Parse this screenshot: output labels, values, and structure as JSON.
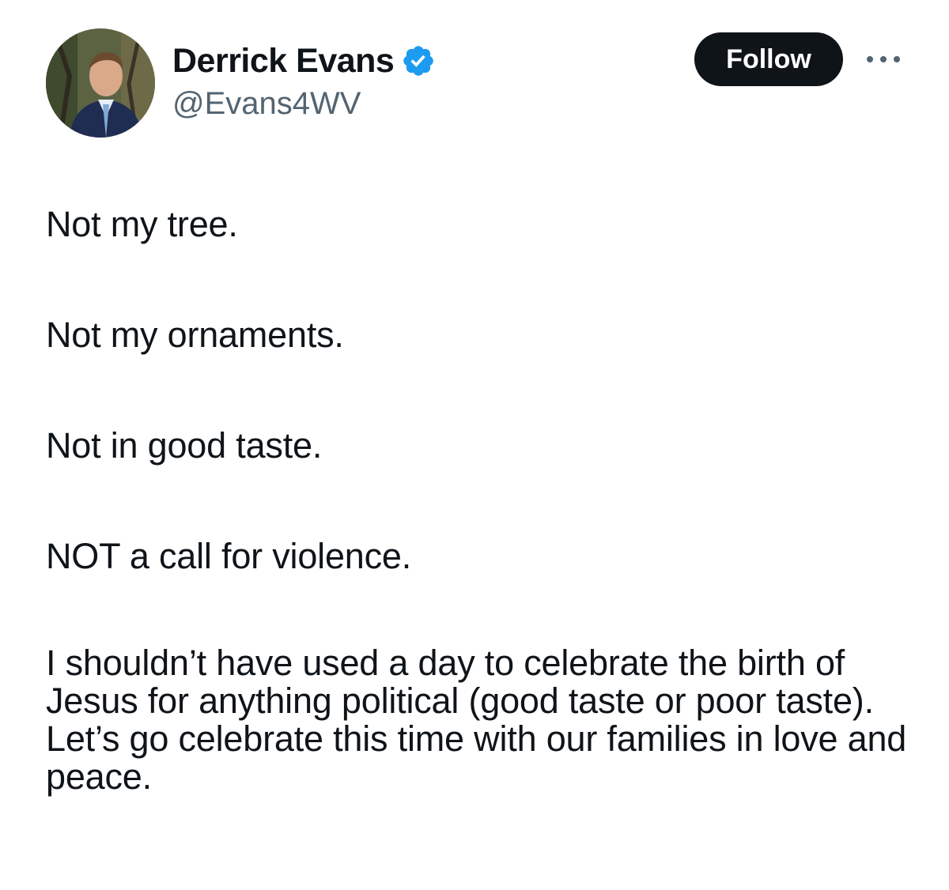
{
  "author": {
    "display_name": "Derrick Evans",
    "handle": "@Evans4WV",
    "verified": true,
    "verified_icon": "verified-badge-icon",
    "verified_color": "#1d9bf0"
  },
  "actions": {
    "follow_label": "Follow",
    "more_icon": "more-options-icon"
  },
  "tweet": {
    "paragraphs": [
      "Not my tree.",
      "Not my ornaments.",
      "Not in good taste.",
      "NOT a call for violence.",
      "I shouldn’t have used a day to celebrate the birth of Jesus for anything political (good taste or poor taste). Let’s go celebrate this time with our families in love and peace."
    ]
  },
  "colors": {
    "text": "#0f1419",
    "secondary_text": "#536471",
    "follow_bg": "#0f1419",
    "follow_text": "#ffffff"
  }
}
